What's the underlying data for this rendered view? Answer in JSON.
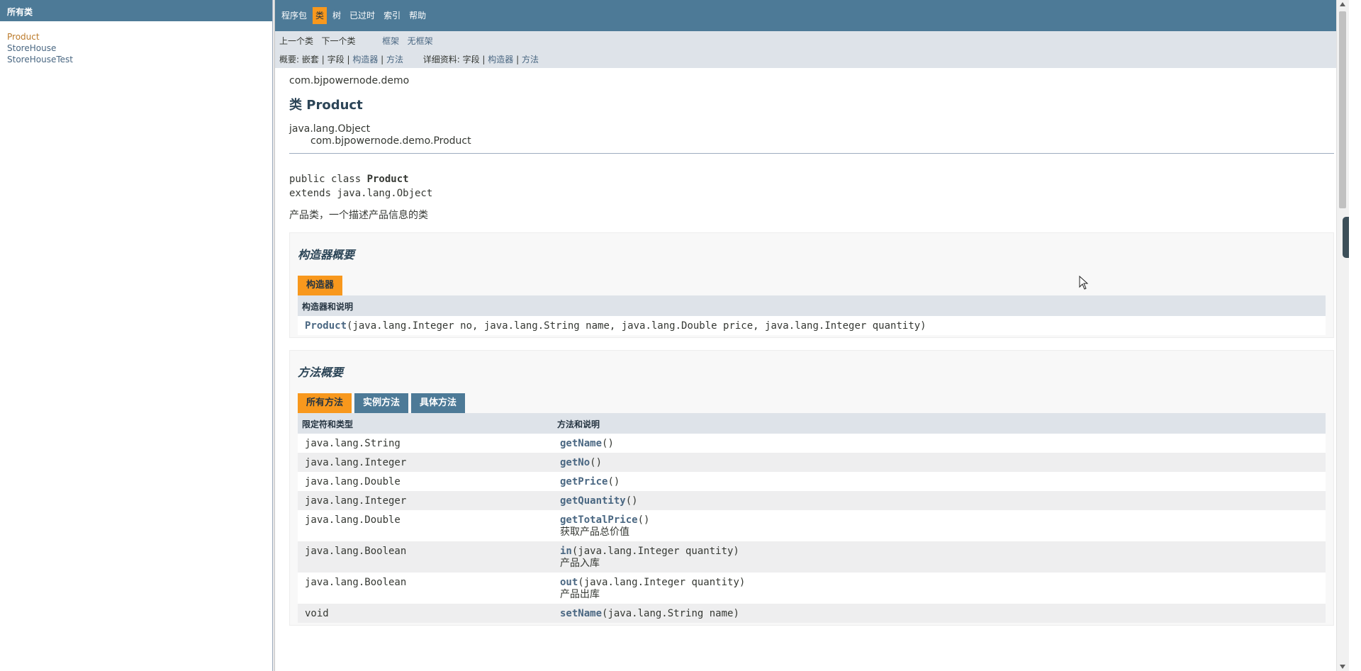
{
  "left_frame": {
    "title": "所有类",
    "classes": [
      {
        "label": "Product"
      },
      {
        "label": "StoreHouse"
      },
      {
        "label": "StoreHouseTest"
      }
    ]
  },
  "top_nav": {
    "items": [
      "程序包",
      "类",
      "树",
      "已过时",
      "索引",
      "帮助"
    ]
  },
  "sub_nav": {
    "prev_class": "上一个类",
    "next_class": "下一个类",
    "frames": "框架",
    "no_frames": "无框架",
    "summary_label": "概要:",
    "summary_nested": "嵌套",
    "summary_field": "字段",
    "summary_constructor": "构造器",
    "summary_method": "方法",
    "detail_label": "详细资料:",
    "detail_field": "字段",
    "detail_constructor": "构造器",
    "detail_method": "方法",
    "sep": "|"
  },
  "header": {
    "package": "com.bjpowernode.demo",
    "class_title": "类 Product",
    "inherit_root": "java.lang.Object",
    "inherit_child": "com.bjpowernode.demo.Product"
  },
  "declaration": {
    "line1_prefix": "public class ",
    "line1_name": "Product",
    "line2": "extends java.lang.Object",
    "description": "产品类，一个描述产品信息的类"
  },
  "constructor_summary": {
    "heading": "构造器概要",
    "tab": "构造器",
    "column": "构造器和说明",
    "rows": [
      {
        "name": "Product",
        "params": "(java.lang.Integer no, java.lang.String name, java.lang.Double price, java.lang.Integer quantity)"
      }
    ]
  },
  "method_summary": {
    "heading": "方法概要",
    "tabs": [
      "所有方法",
      "实例方法",
      "具体方法"
    ],
    "col_type": "限定符和类型",
    "col_method": "方法和说明",
    "rows": [
      {
        "type": "java.lang.String",
        "name": "getName",
        "params": "()",
        "note": ""
      },
      {
        "type": "java.lang.Integer",
        "name": "getNo",
        "params": "()",
        "note": ""
      },
      {
        "type": "java.lang.Double",
        "name": "getPrice",
        "params": "()",
        "note": ""
      },
      {
        "type": "java.lang.Integer",
        "name": "getQuantity",
        "params": "()",
        "note": ""
      },
      {
        "type": "java.lang.Double",
        "name": "getTotalPrice",
        "params": "()",
        "note": "获取产品总价值"
      },
      {
        "type": "java.lang.Boolean",
        "name": "in",
        "params": "(java.lang.Integer quantity)",
        "note": "产品入库"
      },
      {
        "type": "java.lang.Boolean",
        "name": "out",
        "params": "(java.lang.Integer quantity)",
        "note": "产品出库"
      },
      {
        "type": "void",
        "name": "setName",
        "params": "(java.lang.String name)",
        "note": ""
      }
    ]
  }
}
